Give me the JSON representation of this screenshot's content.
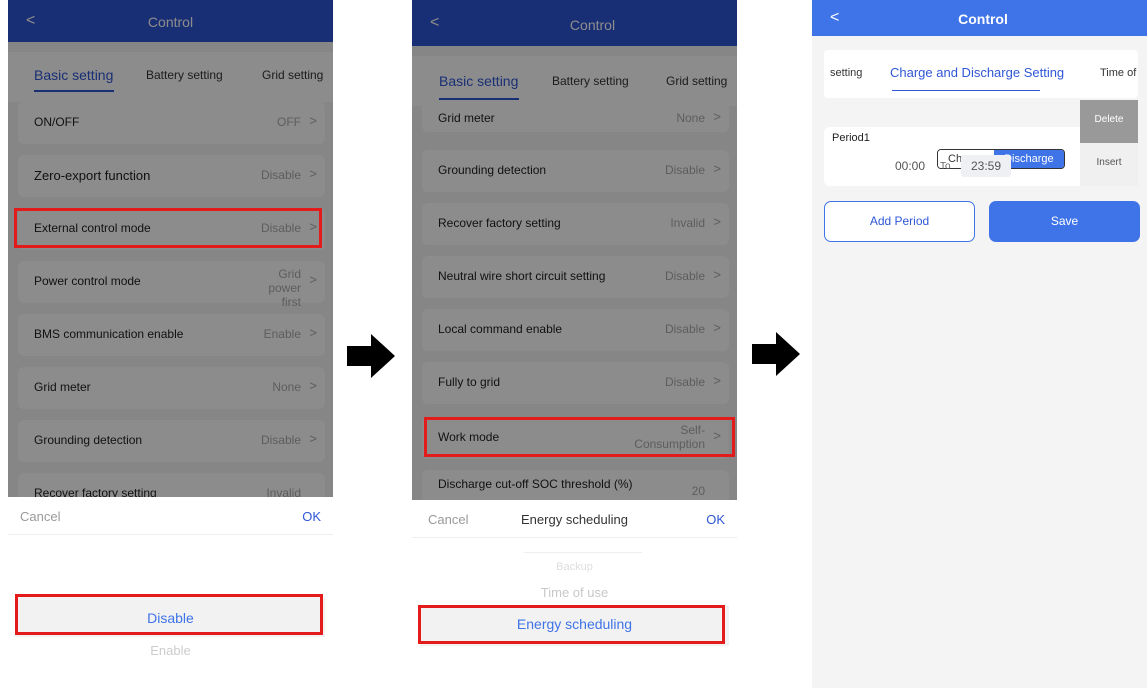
{
  "common": {
    "header_title": "Control",
    "back_symbol": "<",
    "chevron": ">",
    "arrow_icon": "right-arrow-icon"
  },
  "screen1": {
    "tabs": [
      "Basic setting",
      "Battery setting",
      "Grid setting"
    ],
    "rows": [
      {
        "label": "ON/OFF",
        "value": "OFF"
      },
      {
        "label": "Zero-export function",
        "value": "Disable"
      },
      {
        "label": "External control mode",
        "value": "Disable"
      },
      {
        "label": "Power control mode",
        "value": "Grid power first"
      },
      {
        "label": "BMS communication enable",
        "value": "Enable"
      },
      {
        "label": "Grid meter",
        "value": "None"
      },
      {
        "label": "Grounding detection",
        "value": "Disable"
      },
      {
        "label": "Recover factory setting",
        "value": "Invalid"
      }
    ],
    "sheet": {
      "cancel": "Cancel",
      "ok": "OK",
      "title": ""
    },
    "options": [
      "Disable",
      "Enable"
    ]
  },
  "screen2": {
    "tabs": [
      "Basic setting",
      "Battery setting",
      "Grid setting"
    ],
    "rows": [
      {
        "label": "Grid meter",
        "value": "None"
      },
      {
        "label": "Grounding detection",
        "value": "Disable"
      },
      {
        "label": "Recover factory setting",
        "value": "Invalid"
      },
      {
        "label": "Neutral wire short circuit setting",
        "value": "Disable"
      },
      {
        "label": "Local command enable",
        "value": "Disable"
      },
      {
        "label": "Fully to grid",
        "value": "Disable"
      },
      {
        "label": "Work mode",
        "value": "Self-Consumption"
      },
      {
        "label": "Discharge cut-off SOC threshold (%)",
        "value": "20"
      }
    ],
    "sheet": {
      "cancel": "Cancel",
      "ok": "OK",
      "title": "Energy scheduling"
    },
    "options": [
      "Backup",
      "Time of use",
      "Energy scheduling"
    ]
  },
  "screen3": {
    "tabs": [
      "setting",
      "Charge and Discharge Setting",
      "Time of"
    ],
    "period_label": "Period1",
    "charge_label": "Charge",
    "discharge_label": "Discharge",
    "start_time": "00:00",
    "to_label": "To",
    "end_time": "23:59",
    "delete_label": "Delete",
    "insert_label": "Insert",
    "add_period_label": "Add Period",
    "save_label": "Save"
  },
  "colors": {
    "header_blue": "#2f57d6",
    "accent_blue": "#3f73e8",
    "highlight_red": "#e31b1b"
  }
}
